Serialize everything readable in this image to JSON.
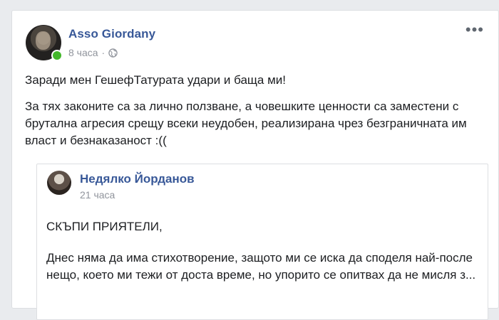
{
  "post": {
    "author": "Asso Giordany",
    "time": "8 часа",
    "sep": "·",
    "privacy_icon": "globe-icon",
    "more_icon": "more-options-icon",
    "more_label": "•••",
    "paragraph1": "Заради мен ГешефТатурата удари и баща ми!",
    "paragraph2": "За тях законите са за лично ползване, а човешките ценности са заместени с брутална агресия срещу всеки неудобен, реализирана чрез безграничната им власт и безнаказаност :(("
  },
  "shared": {
    "author": "Недялко Йорданов",
    "time": "21 часа",
    "paragraph1": "СКЪПИ ПРИЯТЕЛИ,",
    "paragraph2": "Днес няма да има стихотворение, защото ми се иска да споделя най-после нещо, което ми тежи от доста време, но упорито се опитвах да не мисля з..."
  },
  "colors": {
    "link": "#385898",
    "meta": "#90949c",
    "online": "#42b72a"
  }
}
